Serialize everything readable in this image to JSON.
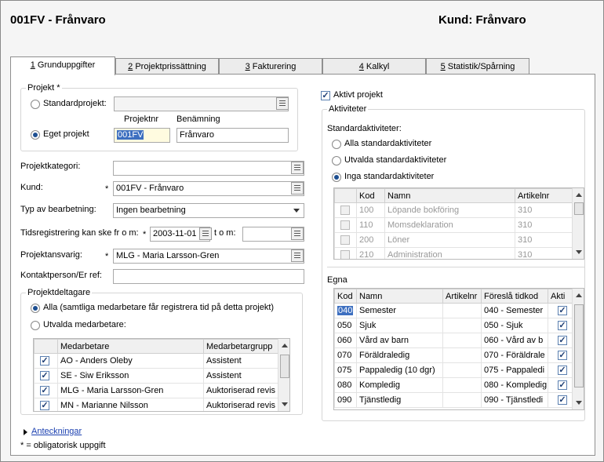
{
  "header": {
    "title": "001FV - Frånvaro",
    "customer": "Kund: Frånvaro"
  },
  "tabs": [
    {
      "num": "1",
      "label": "Grunduppgifter"
    },
    {
      "num": "2",
      "label": "Projektprissättning"
    },
    {
      "num": "3",
      "label": "Fakturering"
    },
    {
      "num": "4",
      "label": "Kalkyl"
    },
    {
      "num": "5",
      "label": "Statistik/Spårning"
    }
  ],
  "projekt": {
    "legend": "Projekt *",
    "standard_label": "Standardprojekt:",
    "eget_label": "Eget projekt",
    "nr_header": "Projektnr",
    "name_header": "Benämning",
    "nr_value": "001FV",
    "name_value": "Frånvaro"
  },
  "form": {
    "kategori_label": "Projektkategori:",
    "kund_label": "Kund:",
    "kund_value": "001FV - Frånvaro",
    "typ_label": "Typ av bearbetning:",
    "typ_value": "Ingen bearbetning",
    "tid_label": "Tidsregistrering kan ske fr o m:",
    "tid_from": "2003-11-01",
    "tom_label": "t o m:",
    "ansvarig_label": "Projektansvarig:",
    "ansvarig_value": "MLG - Maria Larsson-Gren",
    "kontakt_label": "Kontaktperson/Er ref:",
    "star": "*"
  },
  "deltagare": {
    "legend": "Projektdeltagare",
    "alla_label": "Alla (samtliga medarbetare får registrera tid på detta projekt)",
    "utvalda_label": "Utvalda medarbetare:",
    "headers": [
      "Medarbetare",
      "Medarbetargrupp"
    ],
    "rows": [
      {
        "name": "AO - Anders Oleby",
        "group": "Assistent"
      },
      {
        "name": "SE - Siw Eriksson",
        "group": "Assistent"
      },
      {
        "name": "MLG - Maria Larsson-Gren",
        "group": "Auktoriserad revis"
      },
      {
        "name": "MN - Marianne Nilsson",
        "group": "Auktoriserad revis"
      }
    ]
  },
  "footer": {
    "anteckningar": "Anteckningar",
    "obligatorisk": "* = obligatorisk uppgift"
  },
  "aktivt_label": "Aktivt projekt",
  "aktiviteter": {
    "legend": "Aktiviteter",
    "standard_header": "Standardaktiviteter:",
    "opt_alla": "Alla standardaktiviteter",
    "opt_utvalda": "Utvalda standardaktiviteter",
    "opt_inga": "Inga standardaktiviteter",
    "std_headers": [
      "Kod",
      "Namn",
      "Artikelnr"
    ],
    "std_rows": [
      {
        "kod": "100",
        "namn": "Löpande bokföring",
        "art": "310"
      },
      {
        "kod": "110",
        "namn": "Momsdeklaration",
        "art": "310"
      },
      {
        "kod": "200",
        "namn": "Löner",
        "art": "310"
      },
      {
        "kod": "210",
        "namn": "Administration",
        "art": "310"
      }
    ],
    "egna_label": "Egna",
    "egna_headers": [
      "Kod",
      "Namn",
      "Artikelnr",
      "Föreslå tidkod",
      "Akti"
    ],
    "egna_rows": [
      {
        "kod": "040",
        "namn": "Semester",
        "art": "",
        "tid": "040 - Semester"
      },
      {
        "kod": "050",
        "namn": "Sjuk",
        "art": "",
        "tid": "050 - Sjuk"
      },
      {
        "kod": "060",
        "namn": "Vård av barn",
        "art": "",
        "tid": "060 - Vård av b"
      },
      {
        "kod": "070",
        "namn": "Föräldraledig",
        "art": "",
        "tid": "070 - Föräldrale"
      },
      {
        "kod": "075",
        "namn": "Pappaledig (10 dgr)",
        "art": "",
        "tid": "075 - Pappaledi"
      },
      {
        "kod": "080",
        "namn": "Kompledig",
        "art": "",
        "tid": "080 - Kompledig"
      },
      {
        "kod": "090",
        "namn": "Tjänstledig",
        "art": "",
        "tid": "090 - Tjänstledi"
      }
    ]
  },
  "colors": {
    "link": "#1a3fb0",
    "selection": "#3d6fc0",
    "required_field": "#fffbe0"
  }
}
